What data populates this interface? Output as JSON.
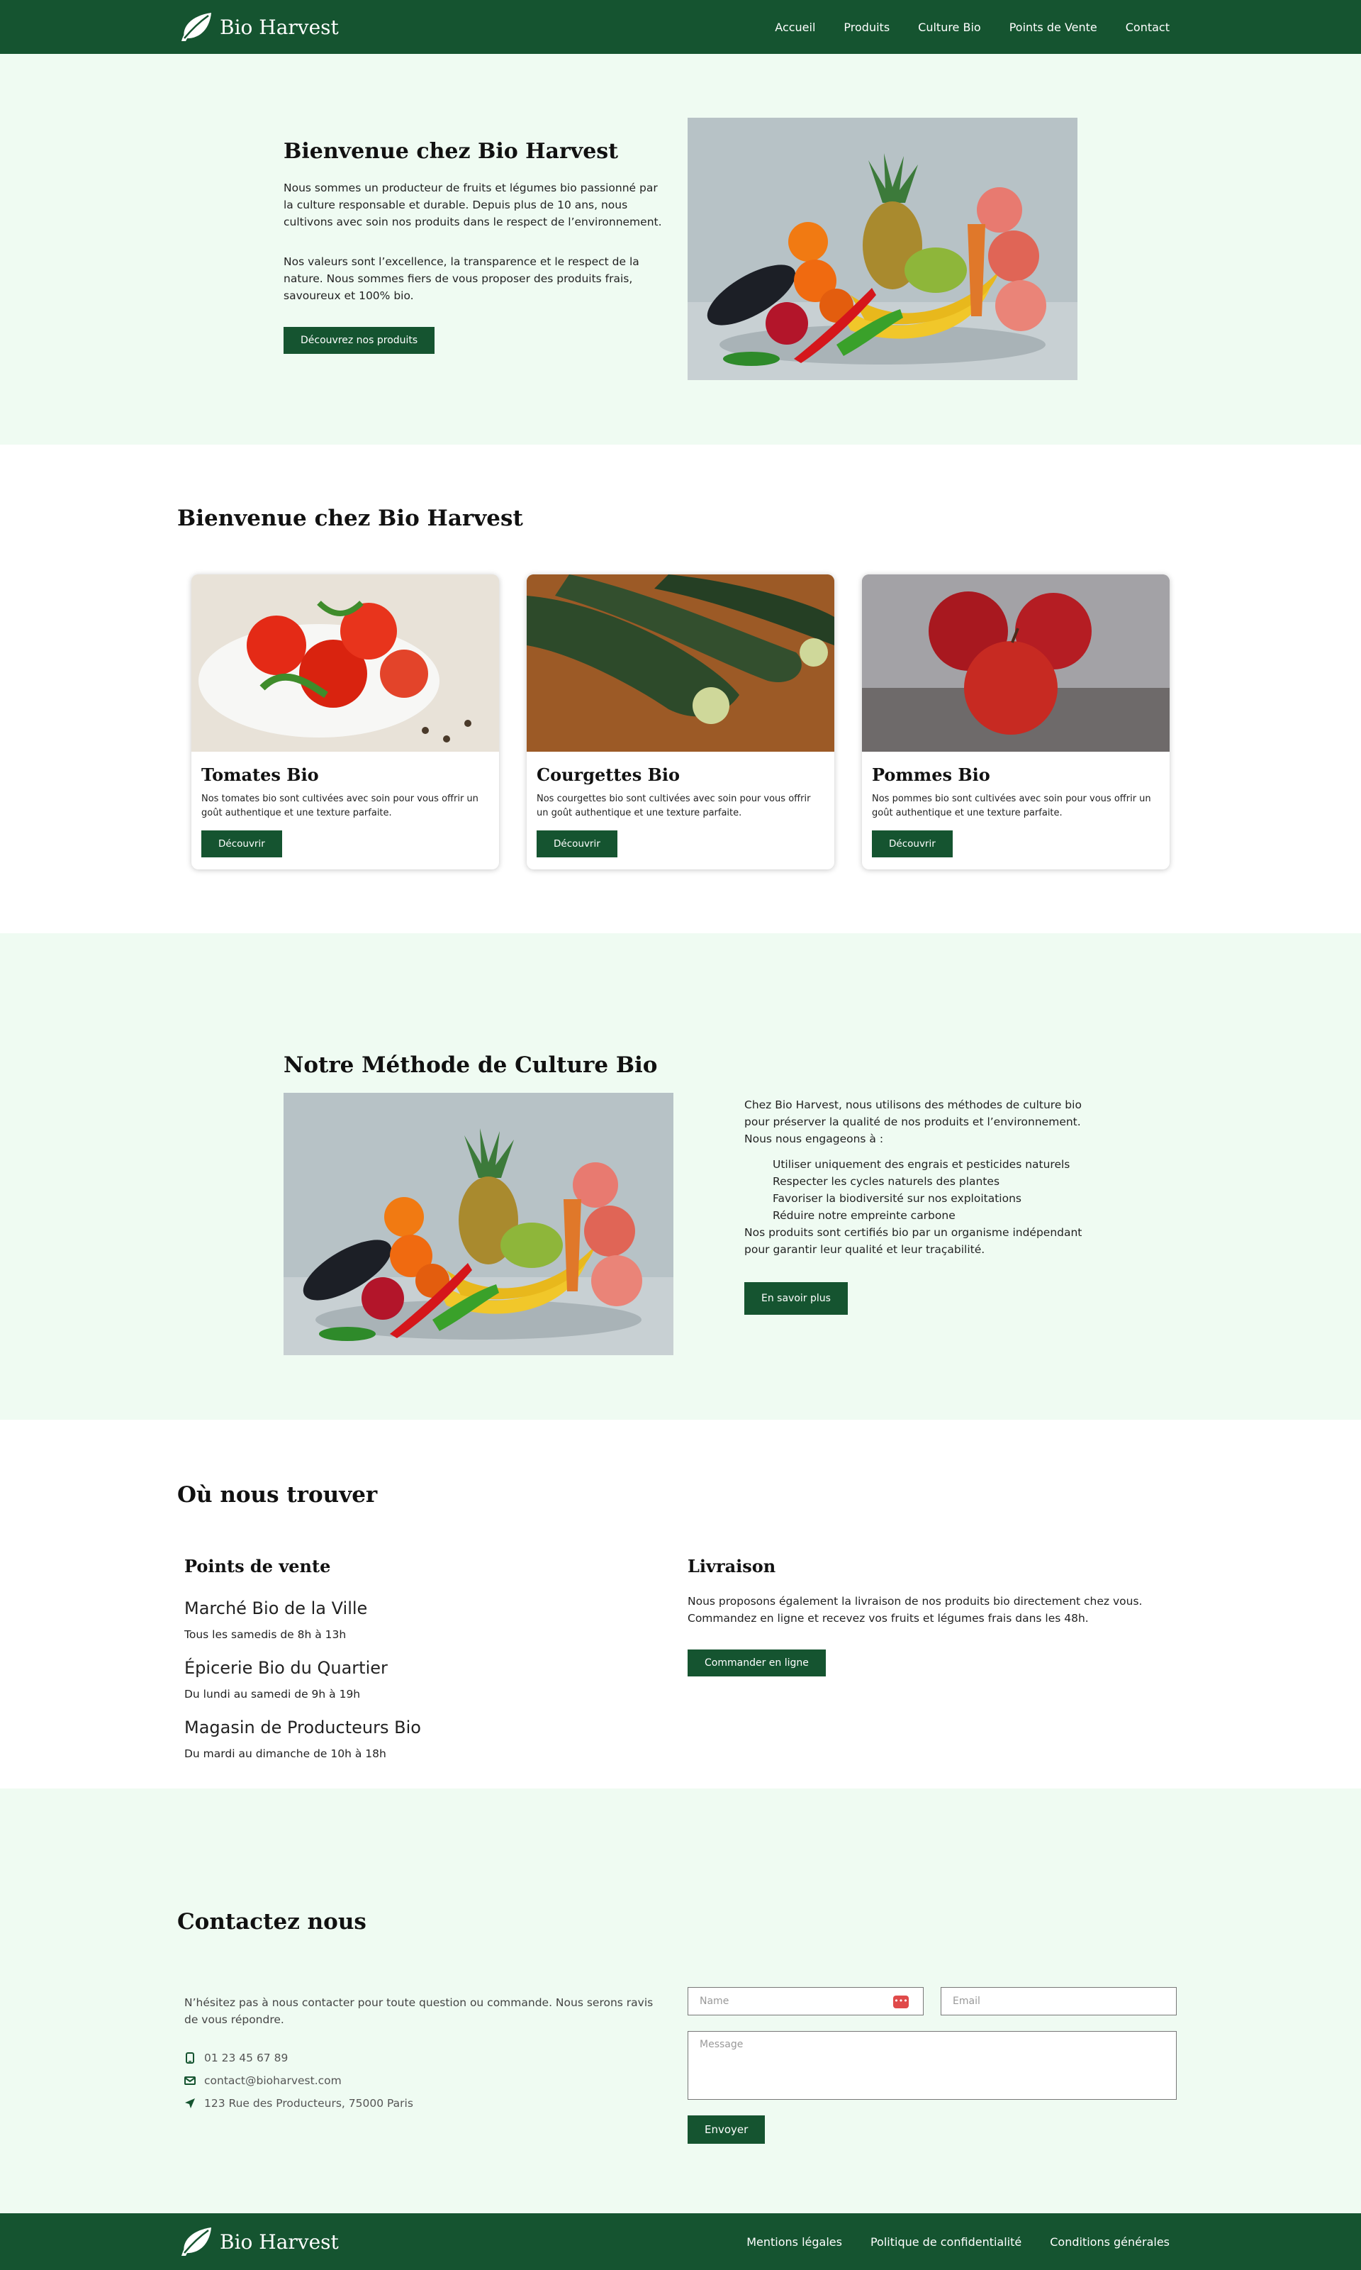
{
  "nav": {
    "brand": "Bio Harvest",
    "links": [
      "Accueil",
      "Produits",
      "Culture Bio",
      "Points de Vente",
      "Contact"
    ]
  },
  "hero": {
    "title": "Bienvenue chez Bio Harvest",
    "p1": "Nous sommes un producteur de fruits et légumes bio passionné par la culture responsable et durable. Depuis plus de 10 ans, nous cultivons avec soin nos produits dans le respect de l’environnement.",
    "p2": "Nos valeurs sont l’excellence, la transparence et le respect de la nature. Nous sommes fiers de vous proposer des produits frais, savoureux et 100% bio.",
    "button": "Découvrez nos produits"
  },
  "products": {
    "title": "Bienvenue chez Bio Harvest",
    "items": [
      {
        "title": "Tomates Bio",
        "desc": "Nos tomates bio sont cultivées avec soin pour vous offrir un goût authentique et une texture parfaite.",
        "button": "Découvrir"
      },
      {
        "title": "Courgettes Bio",
        "desc": "Nos courgettes bio sont cultivées avec soin pour vous offrir un goût authentique et une texture parfaite.",
        "button": "Découvrir"
      },
      {
        "title": "Pommes Bio",
        "desc": "Nos pommes bio sont cultivées avec soin pour vous offrir un goût authentique et une texture parfaite.",
        "button": "Découvrir"
      }
    ]
  },
  "method": {
    "title": "Notre Méthode de Culture Bio",
    "intro": "Chez Bio Harvest, nous utilisons des méthodes de culture bio pour préserver la qualité de nos produits et l’environnement. Nous nous engageons à :",
    "list": [
      "Utiliser uniquement des engrais et pesticides naturels",
      "Respecter les cycles naturels des plantes",
      "Favoriser la biodiversité sur nos exploitations",
      "Réduire notre empreinte carbone"
    ],
    "outro": "Nos produits sont certifiés bio par un organisme indépendant pour garantir leur qualité et leur traçabilité.",
    "button": "En savoir plus"
  },
  "locations": {
    "title": "Où nous trouver",
    "points_title": "Points de vente",
    "stores": [
      {
        "name": "Marché Bio de la Ville",
        "hours": "Tous les samedis de 8h à 13h"
      },
      {
        "name": "Épicerie Bio du Quartier",
        "hours": "Du lundi au samedi de 9h à 19h"
      },
      {
        "name": "Magasin de Producteurs Bio",
        "hours": "Du mardi au dimanche de 10h à 18h"
      }
    ],
    "delivery_title": "Livraison",
    "delivery_text": "Nous proposons également la livraison de nos produits bio directement chez vous. Commandez en ligne et recevez vos fruits et légumes frais dans les 48h.",
    "delivery_button": "Commander en ligne"
  },
  "contact": {
    "title": "Contactez nous",
    "intro": "N’hésitez pas à nous contacter pour toute question ou commande. Nous serons ravis de vous répondre.",
    "phone": "01 23 45 67 89",
    "email": "contact@bioharvest.com",
    "address": "123 Rue des Producteurs, 75000 Paris",
    "name_placeholder": "Name",
    "email_placeholder": "Email",
    "message_placeholder": "Message",
    "send": "Envoyer"
  },
  "footer": {
    "brand": "Bio Harvest",
    "links": [
      "Mentions légales",
      "Politique de confidentialité",
      "Conditions générales"
    ]
  },
  "colors": {
    "primary": "#155430",
    "light_bg": "#effbf2"
  }
}
